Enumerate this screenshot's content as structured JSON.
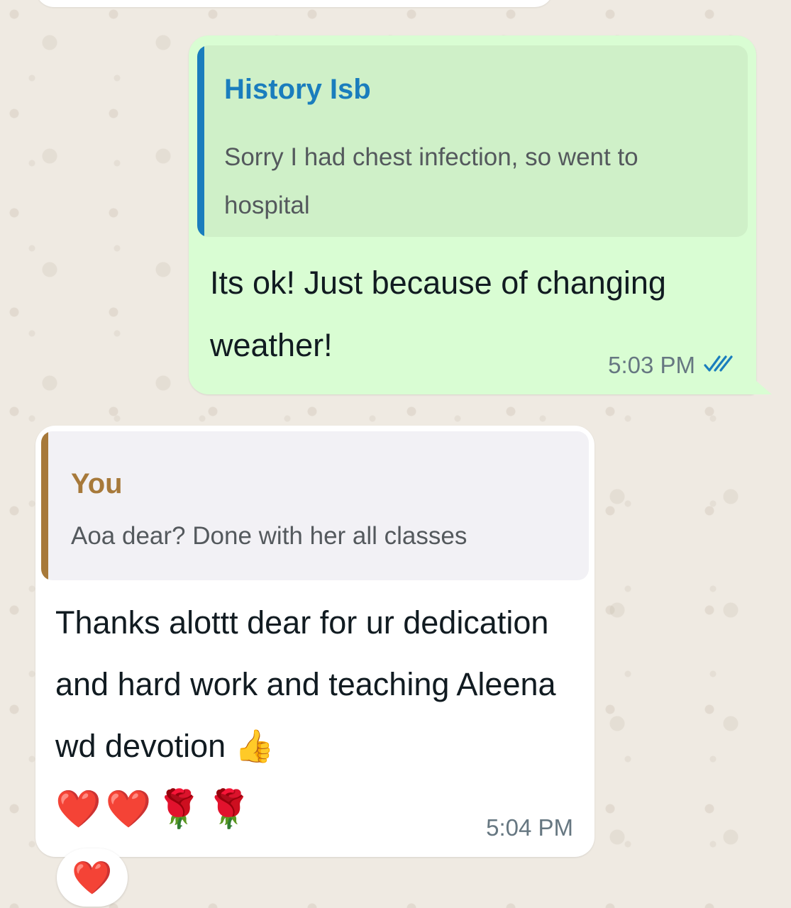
{
  "outgoing": {
    "quote_sender": "History Isb",
    "quote_text": "Sorry I had chest infection, so went to hospital",
    "text": "Its ok! Just because of changing weather!",
    "time": "5:03 PM",
    "status_icon": "double-check-read-icon",
    "colors": {
      "bubble": "#d9fdd3",
      "quote_bar": "#1a7dbd",
      "read_ticks": "#1a7dbd"
    }
  },
  "incoming": {
    "quote_sender": "You",
    "quote_text": "Aoa dear? Done with her all classes",
    "text": "Thanks alottt dear for ur dedication and hard work and teaching Aleena wd devotion 👍",
    "emojis": "❤️❤️🌹🌹",
    "time": "5:04 PM",
    "reaction": "❤️",
    "colors": {
      "bubble": "#ffffff",
      "quote_bar": "#a7793a"
    }
  }
}
